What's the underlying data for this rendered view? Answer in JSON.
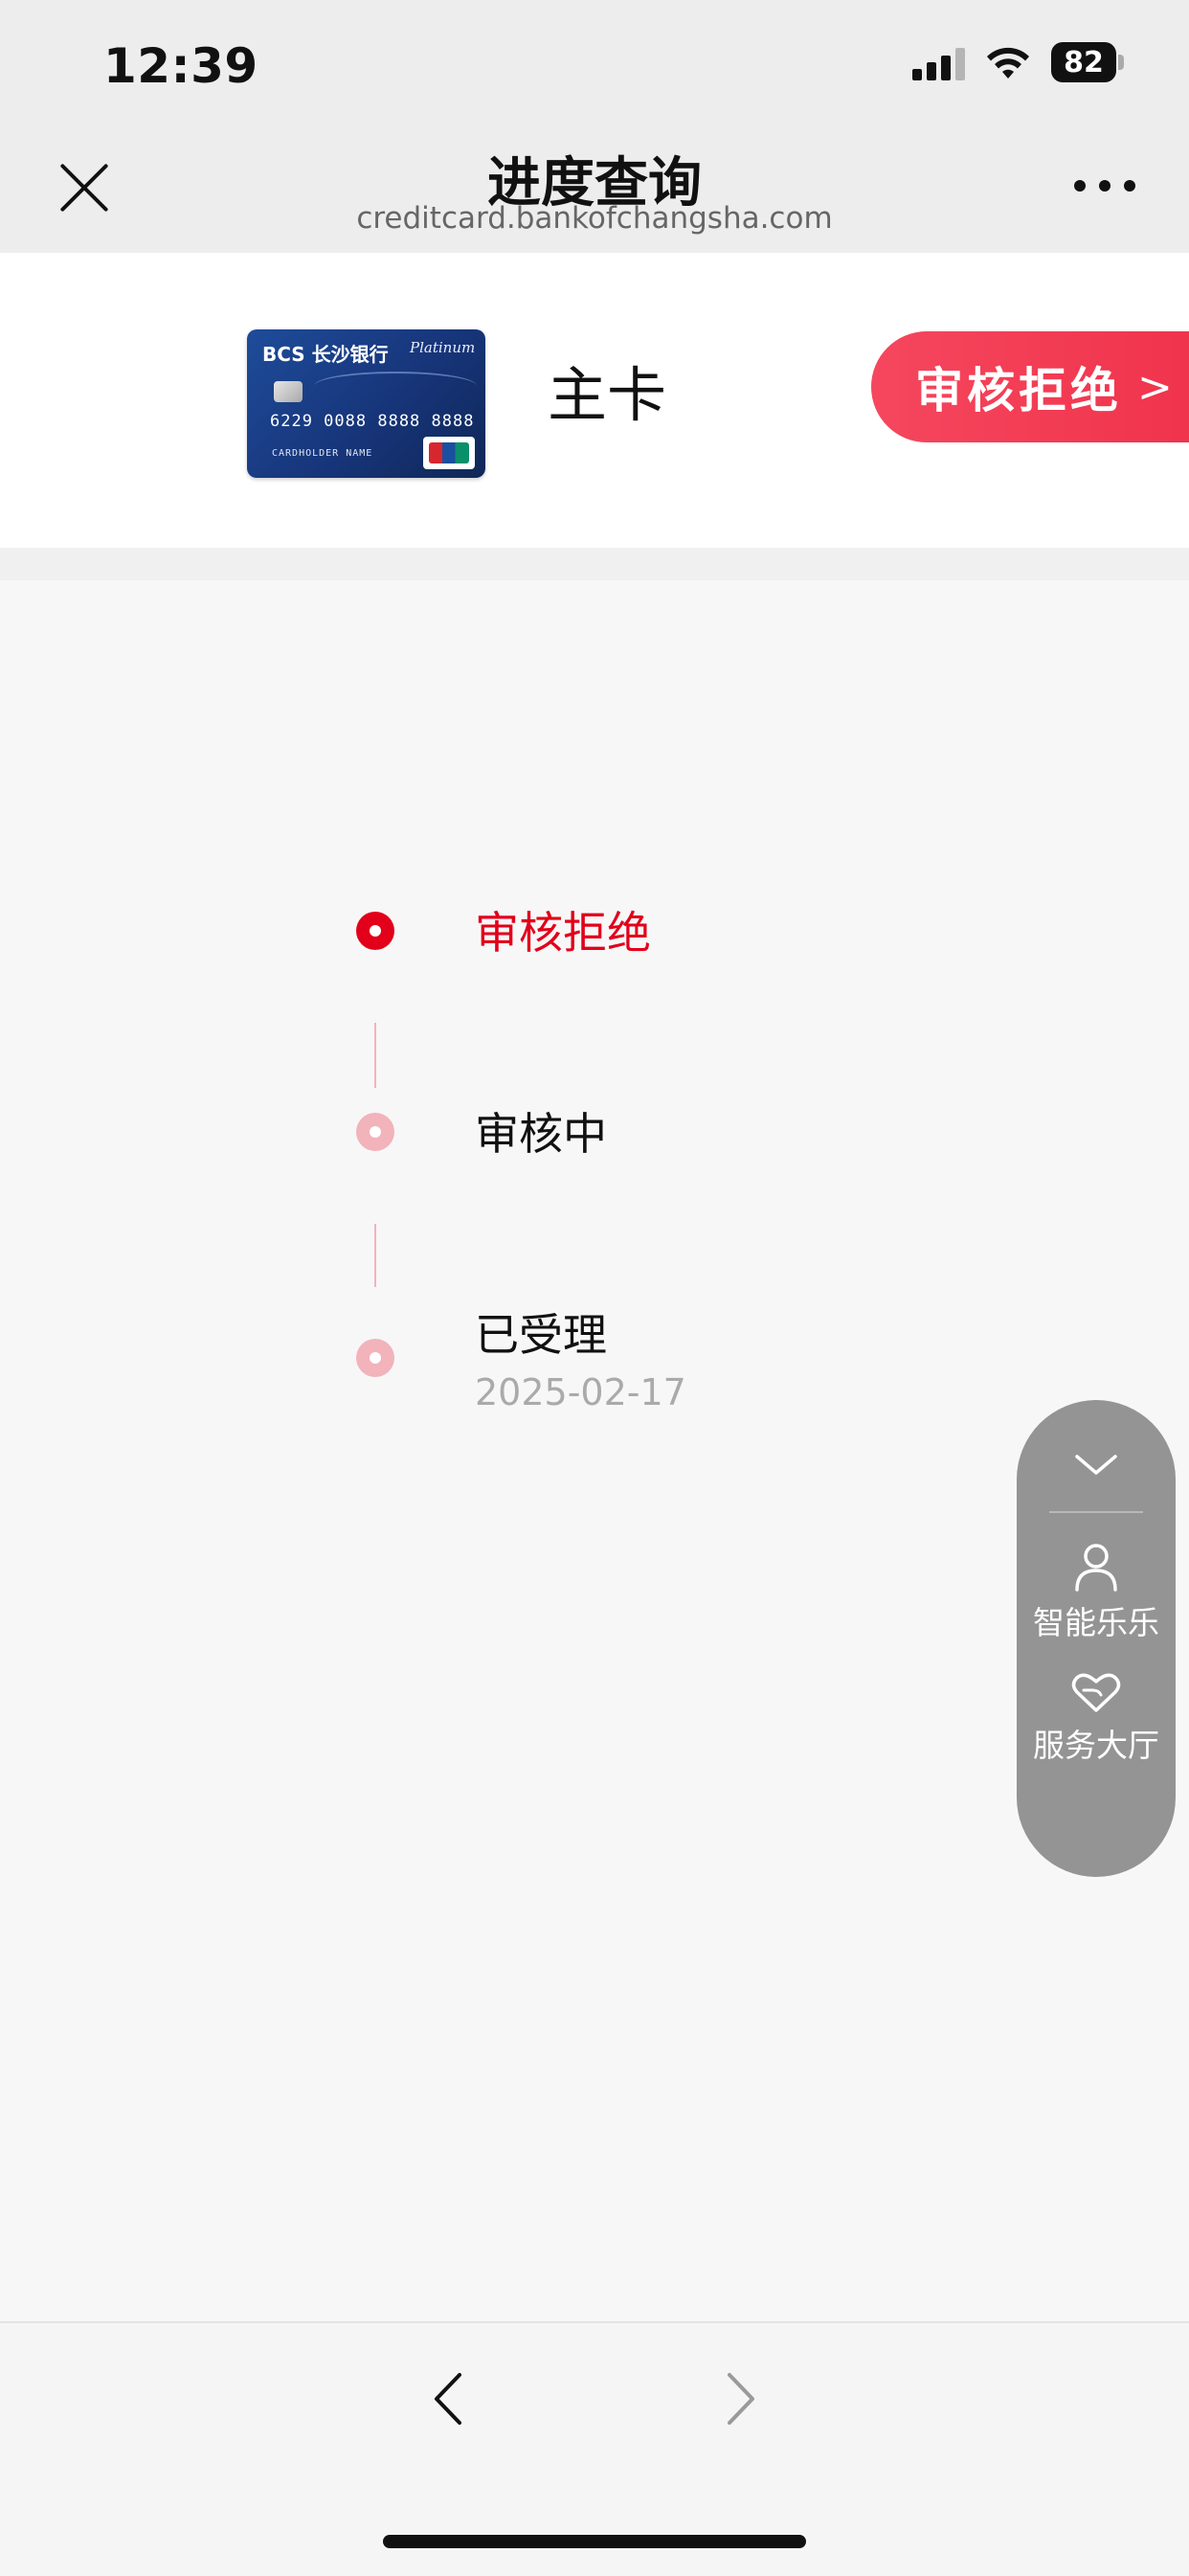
{
  "status_bar": {
    "time": "12:39",
    "battery": "82",
    "icons": [
      "cellular-signal-icon",
      "wifi-icon",
      "battery-icon"
    ]
  },
  "nav": {
    "title": "进度查询",
    "url": "creditcard.bankofchangsha.com",
    "close_icon": "close-icon",
    "more_icon": "more-icon"
  },
  "card": {
    "label": "主卡",
    "image_text": {
      "bank_logo": "BCS 长沙银行",
      "tier": "Platinum",
      "number": "6229 0088 8888 8888",
      "holder": "CARDHOLDER NAME"
    },
    "status_pill": "审核拒绝",
    "status_pill_chevron": ">"
  },
  "timeline": [
    {
      "label": "审核拒绝",
      "date": "",
      "state": "current",
      "color": "#e2001a"
    },
    {
      "label": "审核中",
      "date": "",
      "state": "done",
      "color": "#f2b3bb"
    },
    {
      "label": "已受理",
      "date": "2025-02-17",
      "state": "done",
      "color": "#f2b3bb"
    }
  ],
  "float_panel": {
    "collapse_icon": "chevron-down-icon",
    "items": [
      {
        "label": "智能乐乐",
        "icon": "person-icon"
      },
      {
        "label": "服务大厅",
        "icon": "heart-hand-icon"
      }
    ]
  },
  "bottom_bar": {
    "back_icon": "chevron-left-icon",
    "forward_icon": "chevron-right-icon"
  },
  "colors": {
    "accent": "#e2001a",
    "pill_gradient_start": "#f5475e",
    "pill_gradient_end": "#f0334c",
    "panel_grey": "#949494"
  }
}
